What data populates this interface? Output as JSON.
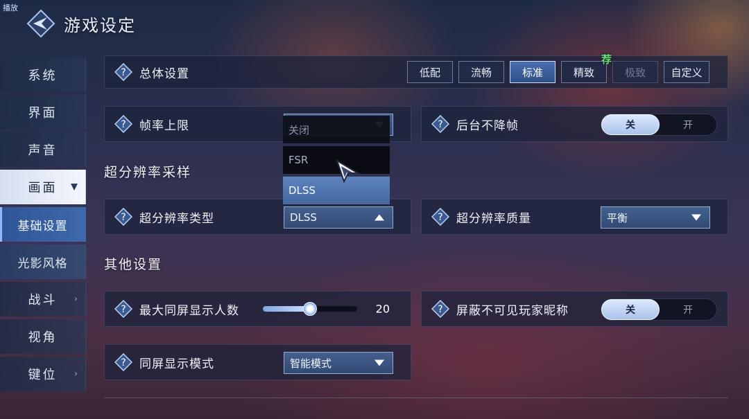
{
  "corner_tag": "播放",
  "header": {
    "title": "游戏设定"
  },
  "sidebar": {
    "items": [
      {
        "label": "系统"
      },
      {
        "label": "界面"
      },
      {
        "label": "声音"
      },
      {
        "label": "画面"
      },
      {
        "label": "基础设置"
      },
      {
        "label": "光影风格"
      },
      {
        "label": "战斗"
      },
      {
        "label": "视角"
      },
      {
        "label": "键位"
      }
    ]
  },
  "overall": {
    "label": "总体设置",
    "presets": [
      "低配",
      "流畅",
      "标准",
      "精致",
      "极致",
      "自定义"
    ],
    "selected": "标准",
    "recommended_badge": "荐"
  },
  "frame_limit": {
    "label": "帧率上限"
  },
  "background_no_drop": {
    "label": "后台不降帧",
    "off": "关",
    "on": "开",
    "value": "关"
  },
  "super_res_section": {
    "title": "超分辨率采样"
  },
  "super_res_type": {
    "label": "超分辨率类型",
    "value": "DLSS",
    "options": [
      "关闭",
      "FSR",
      "DLSS"
    ]
  },
  "super_res_quality": {
    "label": "超分辨率质量",
    "value": "平衡"
  },
  "other_section": {
    "title": "其他设置"
  },
  "max_players": {
    "label": "最大同屏显示人数",
    "value": "20",
    "slider_fraction": 0.5
  },
  "hide_nicknames": {
    "label": "屏蔽不可见玩家昵称",
    "off": "关",
    "on": "开",
    "value": "关"
  },
  "display_mode": {
    "label": "同屏显示模式",
    "value": "智能模式"
  },
  "colors": {
    "accent": "#3f69aa",
    "recommend": "#5fe07a"
  }
}
